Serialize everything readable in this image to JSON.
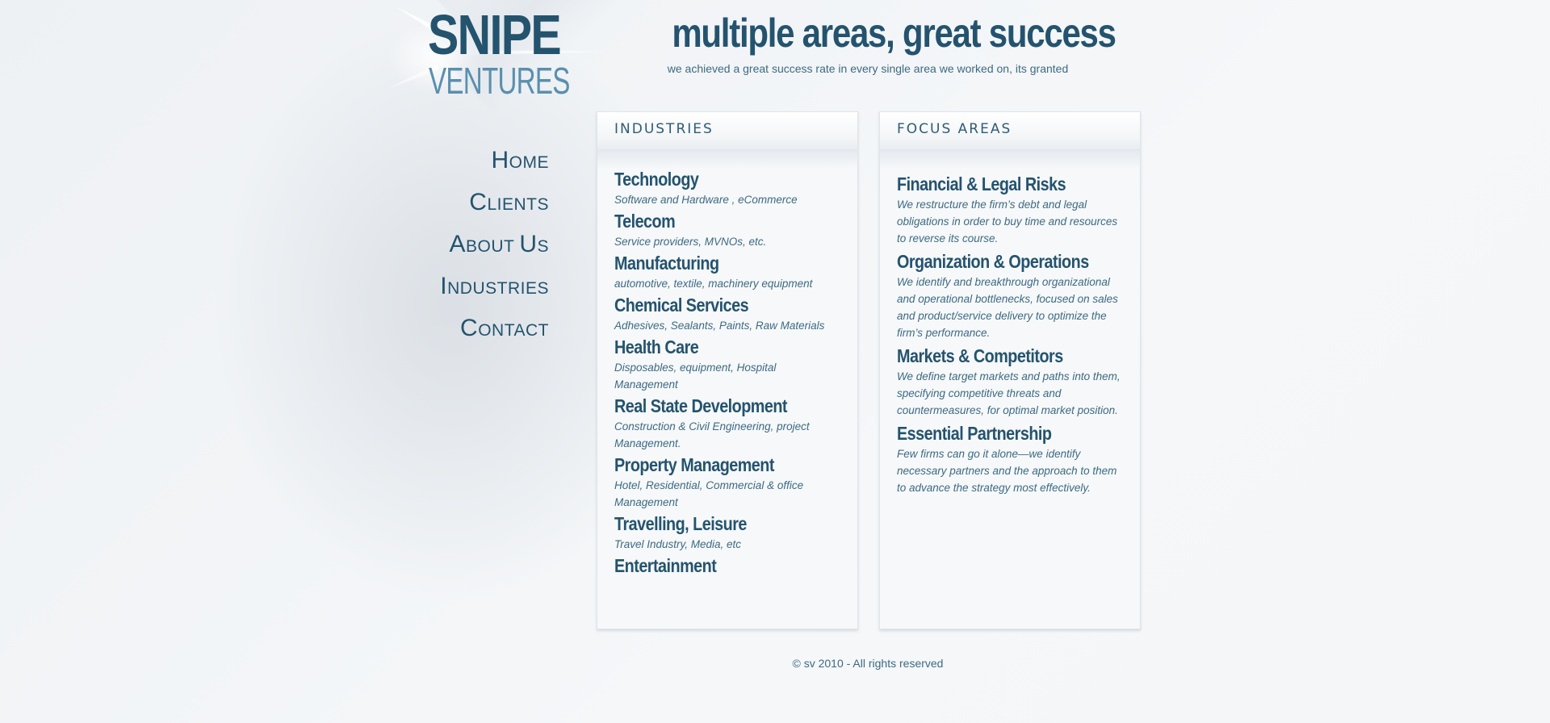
{
  "logo": {
    "line1": "SNIPE",
    "line2": "VENTURES"
  },
  "headline": {
    "title": "multiple areas, great success",
    "subtitle": "we achieved a great success rate in every single area we worked on, its granted"
  },
  "nav": {
    "items": [
      {
        "cap": "H",
        "rest": "ome"
      },
      {
        "cap": "C",
        "rest": "lients"
      },
      {
        "cap": "A",
        "rest": "bout "
      },
      {
        "cap": "I",
        "rest": "ndustries"
      },
      {
        "cap": "C",
        "rest": "ontact"
      }
    ],
    "about_cap2": "U",
    "about_rest2": "s"
  },
  "industries": {
    "title": "INDUSTRIES",
    "items": [
      {
        "name": "Technology",
        "desc": "Software and Hardware , eCommerce"
      },
      {
        "name": "Telecom",
        "desc": "Service providers, MVNOs, etc."
      },
      {
        "name": "Manufacturing",
        "desc": "automotive, textile, machinery equipment"
      },
      {
        "name": "Chemical Services",
        "desc": "Adhesives, Sealants, Paints, Raw Materials"
      },
      {
        "name": "Health Care",
        "desc": "Disposables, equipment, Hospital Management"
      },
      {
        "name": "Real State Development",
        "desc": "Construction & Civil Engineering, project Management."
      },
      {
        "name": "Property Management",
        "desc": "Hotel, Residential, Commercial & office Management"
      },
      {
        "name": "Travelling, Leisure",
        "desc": "Travel Industry, Media, etc"
      },
      {
        "name": "Entertainment",
        "desc": ""
      }
    ]
  },
  "focus": {
    "title": "FOCUS AREAS",
    "items": [
      {
        "name": "Financial & Legal Risks",
        "desc": "We restructure the firm’s debt and legal obligations in order to buy time and resources to reverse its course."
      },
      {
        "name": "Organization & Operations",
        "desc": "We identify and breakthrough organizational and operational bottlenecks, focused on sales and product/service delivery to optimize the firm’s performance."
      },
      {
        "name": "Markets & Competitors",
        "desc": "We define target markets and paths into them, specifying competitive threats and countermeasures, for optimal market position."
      },
      {
        "name": "Essential Partnership",
        "desc": "Few firms can go it alone—we identify necessary partners and the approach to them to advance the strategy most effectively."
      }
    ]
  },
  "footer": {
    "text": "© sv 2010 - All rights reserved"
  }
}
